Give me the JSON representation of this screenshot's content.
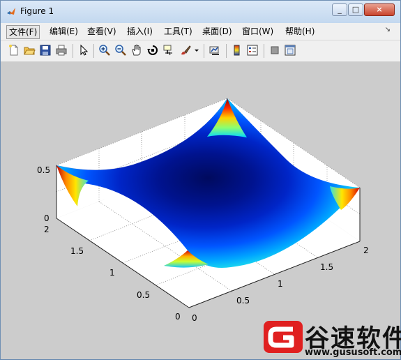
{
  "window": {
    "title": "Figure 1",
    "controls": [
      "_",
      "□",
      "×"
    ]
  },
  "menubar": {
    "items": [
      {
        "label": "文件(F)"
      },
      {
        "label": "编辑(E)"
      },
      {
        "label": "查看(V)"
      },
      {
        "label": "插入(I)"
      },
      {
        "label": "工具(T)"
      },
      {
        "label": "桌面(D)"
      },
      {
        "label": "窗口(W)"
      },
      {
        "label": "帮助(H)"
      }
    ],
    "overflow_arrow": "↘"
  },
  "toolbar": {
    "icons": [
      "new-figure-icon",
      "open-file-icon",
      "save-icon",
      "print-icon",
      "edit-plot-icon",
      "zoom-in-icon",
      "zoom-out-icon",
      "pan-icon",
      "rotate-3d-icon",
      "data-cursor-icon",
      "brush-icon",
      "link-plot-icon",
      "insert-colorbar-icon",
      "insert-legend-icon",
      "hide-plot-tools-icon",
      "show-plot-tools-icon"
    ]
  },
  "plot": {
    "type": "surface",
    "colormap": "jet",
    "z_ticks": [
      "0.5",
      "0"
    ],
    "y_ticks": [
      "2",
      "1.5",
      "1",
      "0.5",
      "0"
    ],
    "x_ticks": [
      "0",
      "0.5",
      "1",
      "1.5",
      "2"
    ],
    "grid": true
  },
  "watermark": {
    "text": "谷速软件",
    "url": "www.gususoft.com",
    "color": "#e02020"
  }
}
